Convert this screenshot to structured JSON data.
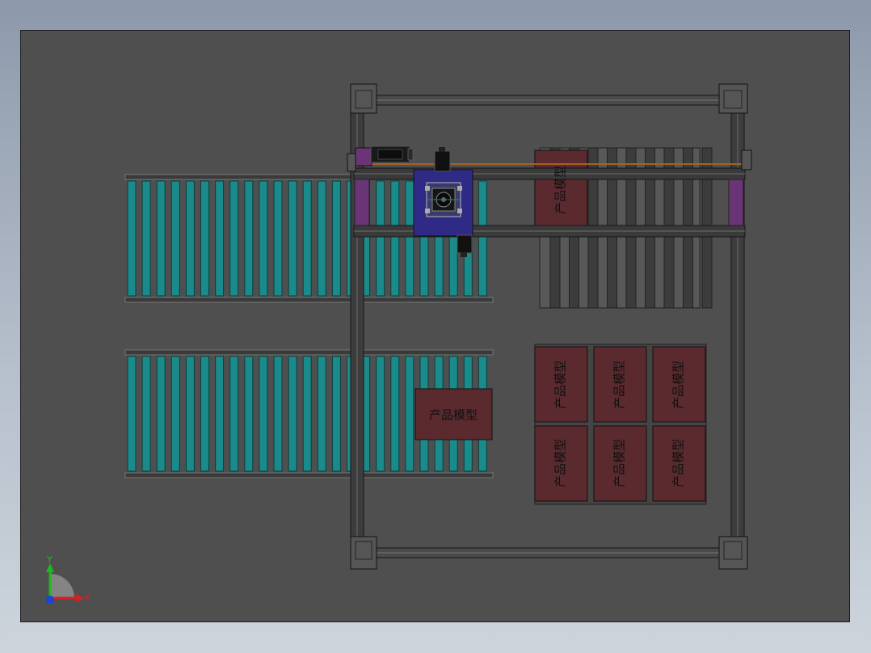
{
  "colors": {
    "viewport_bg": "#4f4f4f",
    "roller": "#1a8a8a",
    "box_fill": "#5a2a2e",
    "carriage": "#2e2a86",
    "accent_purple": "#6a3576"
  },
  "boxes": {
    "label": "产品模型"
  },
  "triad": {
    "x_label": "X",
    "y_label": "Y"
  }
}
